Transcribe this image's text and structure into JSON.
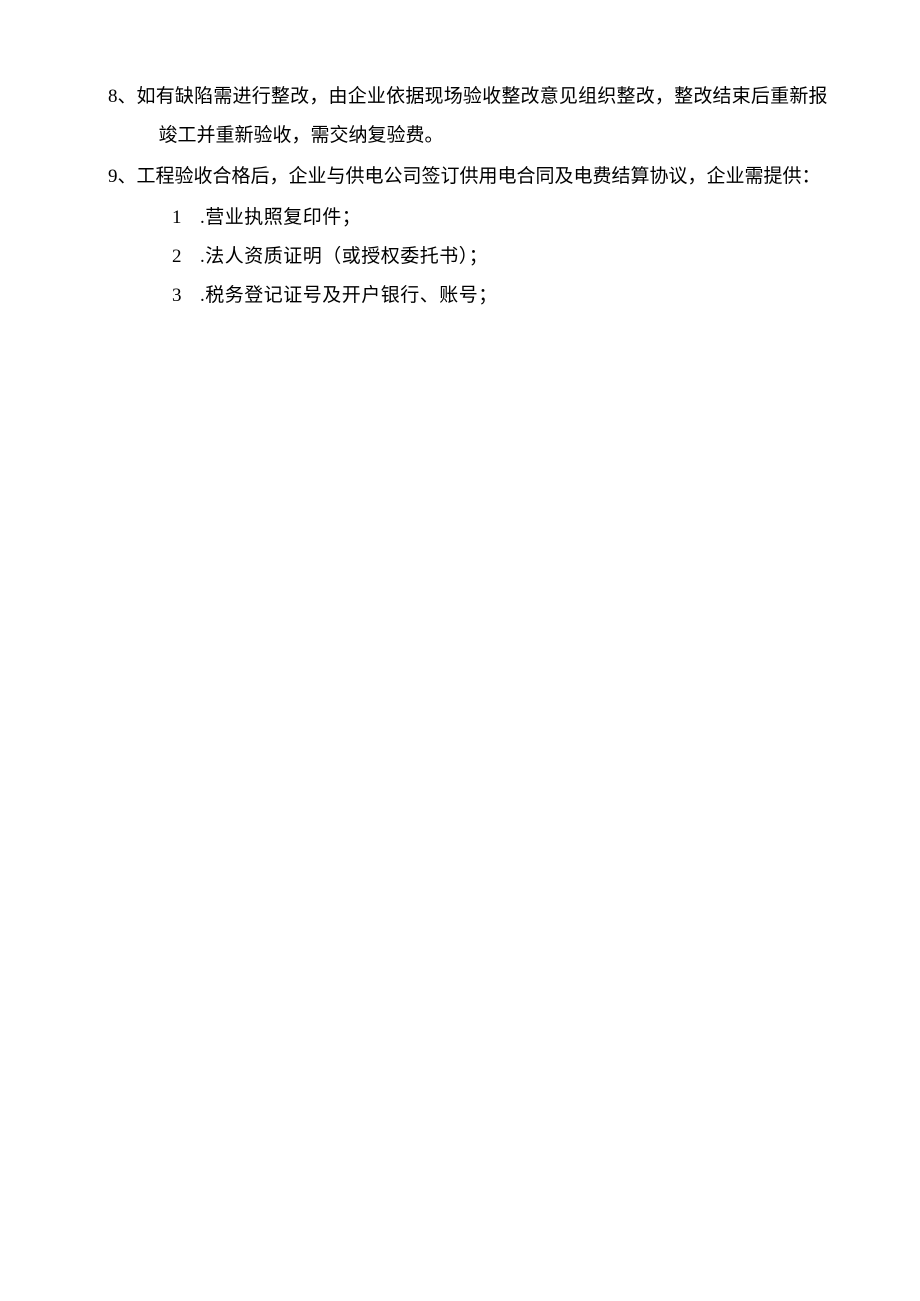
{
  "item8": {
    "number": "8、",
    "line1": "如有缺陷需进行整改，由企业依据现场验收整改意见组织整改，整改结束后重新报",
    "line2": "竣工并重新验收，需交纳复验费。"
  },
  "item9": {
    "number": "9、",
    "text": "工程验收合格后，企业与供电公司签订供用电合同及电费结算协议，企业需提供："
  },
  "sub": [
    {
      "n": "1",
      "t": ".营业执照复印件；"
    },
    {
      "n": "2",
      "t": ".法人资质证明（或授权委托书）；"
    },
    {
      "n": "3",
      "t": ".税务登记证号及开户银行、账号；"
    }
  ]
}
